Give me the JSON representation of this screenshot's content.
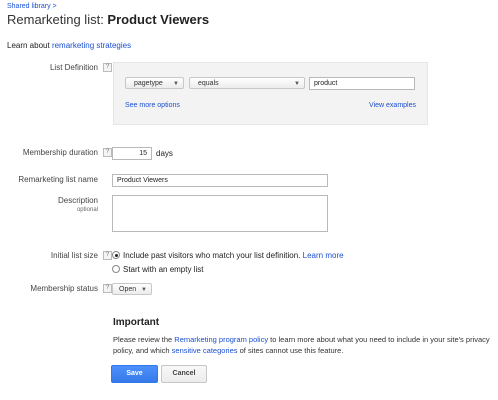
{
  "breadcrumb": "Shared library >",
  "title": {
    "prefix": "Remarketing list: ",
    "name": "Product Viewers"
  },
  "learn": {
    "text": "Learn about ",
    "link": "remarketing strategies"
  },
  "list_definition": {
    "label": "List Definition",
    "rule_field": "pagetype",
    "operator": "equals",
    "value": "product",
    "see_more": "See more options",
    "view_examples": "View examples"
  },
  "membership_duration": {
    "label": "Membership duration",
    "value": "15",
    "unit": "days"
  },
  "list_name": {
    "label": "Remarketing list name",
    "value": "Product Viewers"
  },
  "description": {
    "label": "Description",
    "sublabel": "optional",
    "value": ""
  },
  "initial_size": {
    "label": "Initial list size",
    "option1": "Include past visitors who match your list definition.",
    "option1_link": "Learn more",
    "option2": "Start with an empty list"
  },
  "membership_status": {
    "label": "Membership status",
    "value": "Open"
  },
  "help_glyph": "?",
  "important": {
    "heading": "Important",
    "t1": "Please review the ",
    "l1": "Remarketing program policy",
    "t2": " to learn more about what you need to include in your site's privacy policy, and which ",
    "l2": "sensitive categories",
    "t3": " of sites cannot use this feature."
  },
  "buttons": {
    "save": "Save",
    "cancel": "Cancel"
  }
}
